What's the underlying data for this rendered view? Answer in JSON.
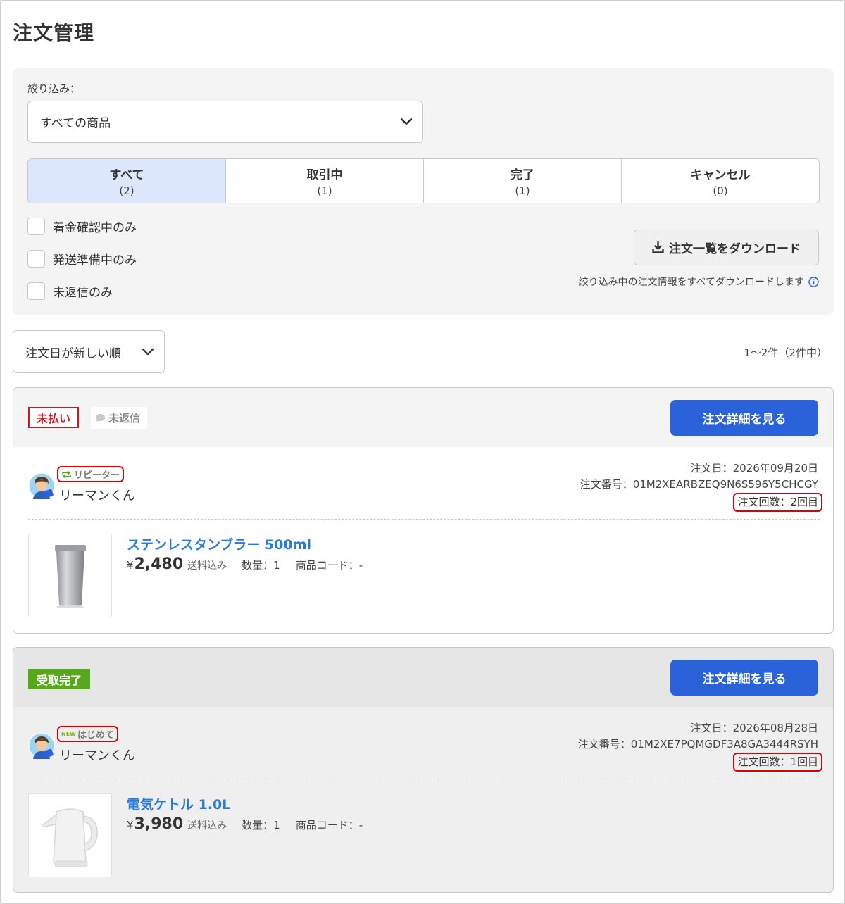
{
  "page": {
    "title": "注文管理"
  },
  "filter": {
    "label": "絞り込み：",
    "product_select": "すべての商品",
    "tabs": [
      {
        "label": "すべて",
        "count": "(2)",
        "active": true
      },
      {
        "label": "取引中",
        "count": "(1)",
        "active": false
      },
      {
        "label": "完了",
        "count": "(1)",
        "active": false
      },
      {
        "label": "キャンセル",
        "count": "(0)",
        "active": false
      }
    ],
    "checkboxes": [
      {
        "label": "着金確認中のみ",
        "checked": false
      },
      {
        "label": "発送準備中のみ",
        "checked": false
      },
      {
        "label": "未返信のみ",
        "checked": false
      }
    ],
    "download_button": "注文一覧をダウンロード",
    "download_note": "絞り込み中の注文情報をすべてダウンロードします"
  },
  "sort": {
    "selected": "注文日が新しい順"
  },
  "result_count": "1〜2件（2件中）",
  "orders": [
    {
      "status": "未払い",
      "reply_status": "未返信",
      "detail_button": "注文詳細を見る",
      "buyer_badge": "リピーター",
      "buyer_name": "リーマンくん",
      "order_date": "注文日：2026年09月20日",
      "order_number": "注文番号：01M2XEARBZEQ9N6S596Y5CHCGY",
      "order_count": "注文回数：2回目",
      "product_name": "ステンレスタンブラー 500ml",
      "yen": "¥",
      "price": "2,480",
      "shipping": "送料込み",
      "quantity": "数量：1",
      "product_code": "商品コード：-"
    },
    {
      "status": "受取完了",
      "detail_button": "注文詳細を見る",
      "buyer_badge_new": "NEW",
      "buyer_badge": "はじめて",
      "buyer_name": "リーマンくん",
      "order_date": "注文日：2026年08月28日",
      "order_number": "注文番号：01M2XE7PQMGDF3A8GA3444RSYH",
      "order_count": "注文回数：1回目",
      "product_name": "電気ケトル 1.0L",
      "yen": "¥",
      "price": "3,980",
      "shipping": "送料込み",
      "quantity": "数量：1",
      "product_code": "商品コード：-"
    }
  ],
  "colors": {
    "accent_blue": "#2a63d9",
    "link_blue": "#2a7bd8",
    "unpaid_red": "#d3151d",
    "done_green": "#58a81d",
    "highlight_red": "#e00000",
    "active_tab": "#dde7fb"
  }
}
